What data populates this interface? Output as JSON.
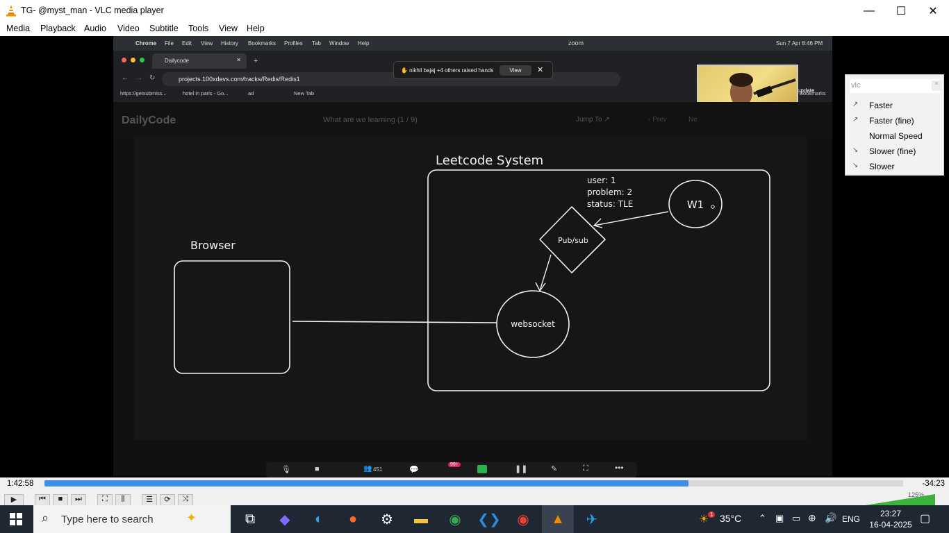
{
  "window": {
    "title": "TG- @myst_man - VLC media player",
    "minimize_glyph": "—",
    "maximize_glyph": "☐",
    "close_glyph": "✕"
  },
  "menu": {
    "items": [
      "Media",
      "Playback",
      "Audio",
      "Video",
      "Subtitle",
      "Tools",
      "View",
      "Help"
    ]
  },
  "video": {
    "mac_menubar": {
      "app": "Chrome",
      "items": [
        "File",
        "Edit",
        "View",
        "History",
        "Bookmarks",
        "Profiles",
        "Tab",
        "Window",
        "Help"
      ],
      "zoom": "zoom",
      "datetime": "Sun 7 Apr  8:46 PM"
    },
    "chrome": {
      "tab_title": "Dailycode",
      "new_tab_glyph": "+",
      "url": "projects.100xdevs.com/tracks/Redis/Redis1",
      "bookmarks": [
        "https://getsubmiss...",
        "hotel in paris - Go...",
        "ad",
        "New Tab"
      ],
      "bookmarks_right": "Bookmarks",
      "update_label": "update"
    },
    "raise_hands": {
      "text": "✋ nikhil bajaj +4 others raised hands",
      "view_label": "View",
      "close_glyph": "✕"
    },
    "site": {
      "logo": "DailyCode",
      "lesson": "What are we learning (1 / 9)",
      "jump_to": "Jump To ↗",
      "prev": "‹  Prev",
      "next": "Ne"
    },
    "diagram": {
      "system_label": "Leetcode System",
      "browser_label": "Browser",
      "pubsub_label": "Pub/sub",
      "w1_label": "W1",
      "websocket_label": "websocket",
      "message_lines": [
        "user: 1",
        "problem: 2",
        "status: TLE"
      ]
    },
    "zoom_toolbar": {
      "participants": "451",
      "chat_badge": "99+"
    }
  },
  "playback": {
    "elapsed": "1:42:58",
    "remaining": "-34:23",
    "progress_fraction": 0.75,
    "volume_label": "125%"
  },
  "controls": {
    "play_glyph": "▶",
    "prev_glyph": "⏮",
    "stop_glyph": "■",
    "next_glyph": "⏭",
    "fullscreen_glyph": "⛶",
    "extended_glyph": "⫼",
    "playlist_glyph": "☰",
    "loop_glyph": "⟳",
    "random_glyph": "⤨"
  },
  "speed_popup": {
    "search_text": "vlc",
    "items": [
      "Faster",
      "Faster (fine)",
      "Normal Speed",
      "Slower (fine)",
      "Slower"
    ]
  },
  "taskbar": {
    "search_placeholder": "Type here to search",
    "weather": "35°C",
    "weather_badge": "1",
    "language": "ENG",
    "time": "23:27",
    "date": "16-04-2025"
  },
  "colors": {
    "progress": "#3d8ee8",
    "taskbar": "#1f2733",
    "vlc_orange": "#f08a00"
  }
}
